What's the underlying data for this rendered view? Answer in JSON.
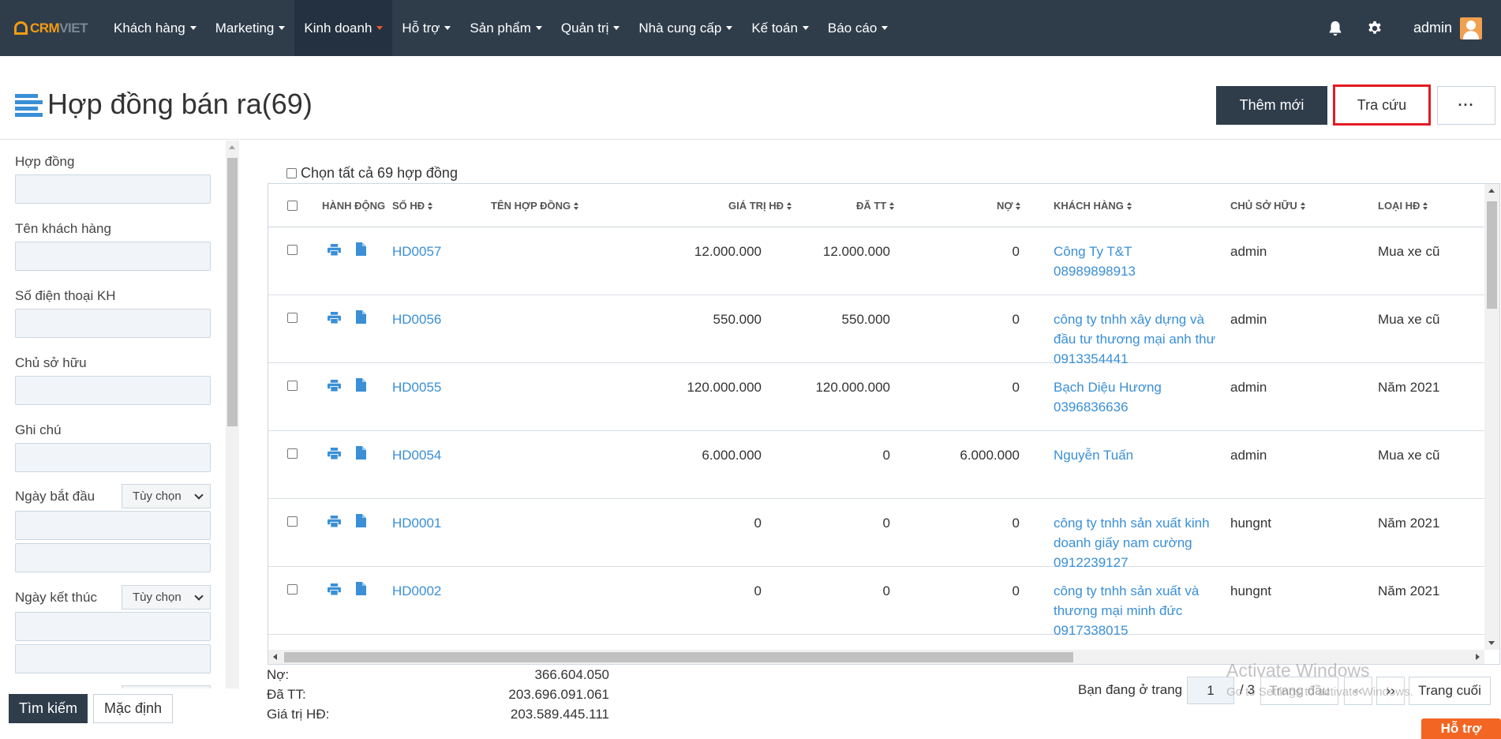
{
  "brand": {
    "logo_left": "CRM",
    "logo_right": "VIET"
  },
  "nav": {
    "items": [
      {
        "label": "Khách hàng"
      },
      {
        "label": "Marketing"
      },
      {
        "label": "Kinh doanh"
      },
      {
        "label": "Hỗ trợ"
      },
      {
        "label": "Sản phẩm"
      },
      {
        "label": "Quản trị"
      },
      {
        "label": "Nhà cung cấp"
      },
      {
        "label": "Kế toán"
      },
      {
        "label": "Báo cáo"
      }
    ],
    "active_index": 2,
    "user": "admin"
  },
  "page": {
    "title": "Hợp đồng bán ra(69)",
    "add_label": "Thêm mới",
    "search_label": "Tra cứu",
    "more_label": "···"
  },
  "sidebar": {
    "contract_label": "Hợp đồng",
    "customer_label": "Tên khách hàng",
    "phone_label": "Số điện thoại KH",
    "owner_label": "Chủ sở hữu",
    "note_label": "Ghi chú",
    "start_label": "Ngày bắt đầu",
    "start_option": "Tùy chọn",
    "end_label": "Ngày kết thúc",
    "end_option": "Tùy chọn",
    "find_label": "Tìm kiếm",
    "default_label": "Mặc định"
  },
  "table": {
    "select_all": "Chọn tất cả 69 hợp đồng",
    "headers": {
      "action": "HÀNH ĐỘNG",
      "number": "SỐ HĐ",
      "name": "TÊN HỢP ĐỒNG",
      "value": "GIÁ TRỊ HĐ",
      "paid": "ĐÃ TT",
      "debt": "NỢ",
      "customer": "KHÁCH HÀNG",
      "owner": "CHỦ SỞ HỮU",
      "type": "LOẠI HĐ"
    },
    "rows": [
      {
        "number": "HD0057",
        "value": "12.000.000",
        "paid": "12.000.000",
        "debt": "0",
        "customer": [
          "Công Ty T&T",
          "08989898913"
        ],
        "owner": "admin",
        "type": "Mua xe cũ"
      },
      {
        "number": "HD0056",
        "value": "550.000",
        "paid": "550.000",
        "debt": "0",
        "customer": [
          "công ty tnhh xây dựng và",
          "đầu tư thương mại anh thư",
          "0913354441"
        ],
        "owner": "admin",
        "type": "Mua xe cũ"
      },
      {
        "number": "HD0055",
        "value": "120.000.000",
        "paid": "120.000.000",
        "debt": "0",
        "customer": [
          "Bạch Diệu Hương",
          "0396836636"
        ],
        "owner": "admin",
        "type": "Năm 2021"
      },
      {
        "number": "HD0054",
        "value": "6.000.000",
        "paid": "0",
        "debt": "6.000.000",
        "customer": [
          "Nguyễn Tuấn"
        ],
        "owner": "admin",
        "type": "Mua xe cũ"
      },
      {
        "number": "HD0001",
        "value": "0",
        "paid": "0",
        "debt": "0",
        "customer": [
          "công ty tnhh sản xuất kinh",
          "doanh giấy nam cường",
          "0912239127"
        ],
        "owner": "hungnt",
        "type": "Năm 2021"
      },
      {
        "number": "HD0002",
        "value": "0",
        "paid": "0",
        "debt": "0",
        "customer": [
          "công ty tnhh sản xuất và",
          "thương mại minh đức",
          "0917338015"
        ],
        "owner": "hungnt",
        "type": "Năm 2021"
      }
    ]
  },
  "summary": {
    "debt_label": "Nợ:",
    "debt_value": "366.604.050",
    "paid_label": "Đã TT:",
    "paid_value": "203.696.091.061",
    "value_label": "Giá trị HĐ:",
    "value_value": "203.589.445.111"
  },
  "pagination": {
    "prefix": "Bạn đang ở trang",
    "current": "1",
    "total": "/ 3",
    "first": "Trang đầu",
    "prev": "‹‹",
    "next": "››",
    "last": "Trang cuối"
  },
  "watermark": {
    "line1": "Activate Windows",
    "line2": "Go to Settings to activate Windows."
  },
  "help_label": "Hỗ trợ",
  "colors": {
    "navbar": "#2f3d4b",
    "accent": "#3a8fd6",
    "highlight": "#e31b23",
    "help": "#f26522"
  }
}
